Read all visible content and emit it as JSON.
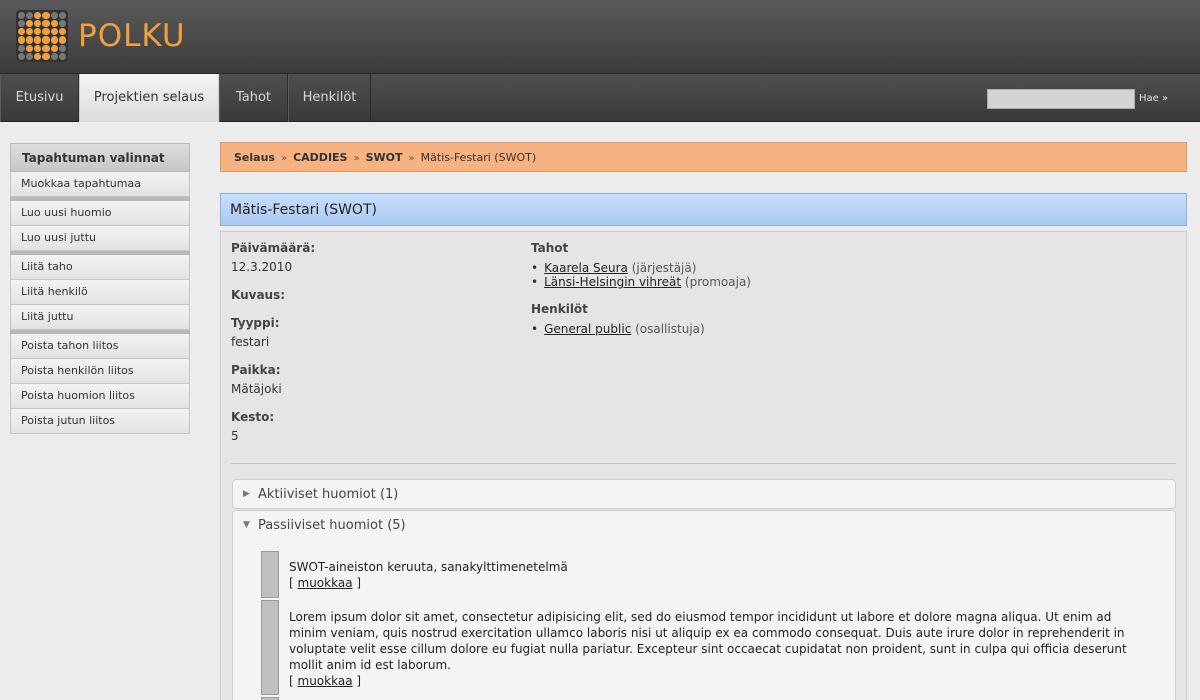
{
  "app": {
    "logo_text": "POLKU"
  },
  "nav": {
    "tabs": [
      {
        "label": "Etusivu",
        "active": false
      },
      {
        "label": "Projektien selaus",
        "active": true
      },
      {
        "label": "Tahot",
        "active": false
      },
      {
        "label": "Henkilöt",
        "active": false
      }
    ],
    "search": {
      "value": "",
      "button_label": "Hae »"
    }
  },
  "sidebar": {
    "heading": "Tapahtuman valinnat",
    "items": [
      "Muokkaa tapahtumaa",
      "Luo uusi huomio",
      "Luo uusi juttu",
      "Liitä taho",
      "Liitä henkilö",
      "Liitä juttu",
      "Poista tahon liitos",
      "Poista henkilön liitos",
      "Poista huomion liitos",
      "Poista jutun liitos"
    ]
  },
  "breadcrumb": {
    "items": [
      "Selaus",
      "CADDIES",
      "SWOT",
      "Mätis-Festari (SWOT)"
    ],
    "separator": "»"
  },
  "page": {
    "title": "Mätis-Festari (SWOT)",
    "fields": {
      "date_label": "Päivämäärä:",
      "date_value": "12.3.2010",
      "description_label": "Kuvaus:",
      "type_label": "Tyyppi:",
      "type_value": "festari",
      "place_label": "Paikka:",
      "place_value": "Mätäjoki",
      "duration_label": "Kesto:",
      "duration_value": "5"
    },
    "parties": {
      "label": "Tahot",
      "items": [
        {
          "name": "Kaarela Seura",
          "role": "(järjestäjä)"
        },
        {
          "name": "Länsi-Helsingin vihreät",
          "role": "(promoaja)"
        }
      ]
    },
    "persons": {
      "label": "Henkilöt",
      "items": [
        {
          "name": "General public",
          "role": "(osallistuja)"
        }
      ]
    }
  },
  "accordion": {
    "active_label": "Aktiiviset huomiot (1)",
    "passive_label": "Passiiviset huomiot (5)",
    "notes": [
      {
        "text": "SWOT-aineiston keruuta, sanakylttimenetelmä",
        "edit_open": "[",
        "edit_label": "muokkaa",
        "edit_close": "]"
      },
      {
        "text": "Lorem ipsum dolor sit amet, consectetur adipisicing elit, sed do eiusmod tempor incididunt ut labore et dolore magna aliqua. Ut enim ad minim veniam, quis nostrud exercitation ullamco laboris nisi ut aliquip ex ea commodo consequat. Duis aute irure dolor in reprehenderit in voluptate velit esse cillum dolore eu fugiat nulla pariatur. Excepteur sint occaecat cupidatat non proident, sunt in culpa qui officia deserunt mollit anim id est laborum.",
        "edit_open": "[",
        "edit_label": "muokkaa",
        "edit_close": "]"
      }
    ]
  },
  "colors": {
    "header_dark": "#3b3b3b",
    "logo_orange": "#f0a040",
    "breadcrumb_bg": "#f7b281",
    "title_bg": "#a9c9f3",
    "content_bg": "#e5e5e5"
  }
}
